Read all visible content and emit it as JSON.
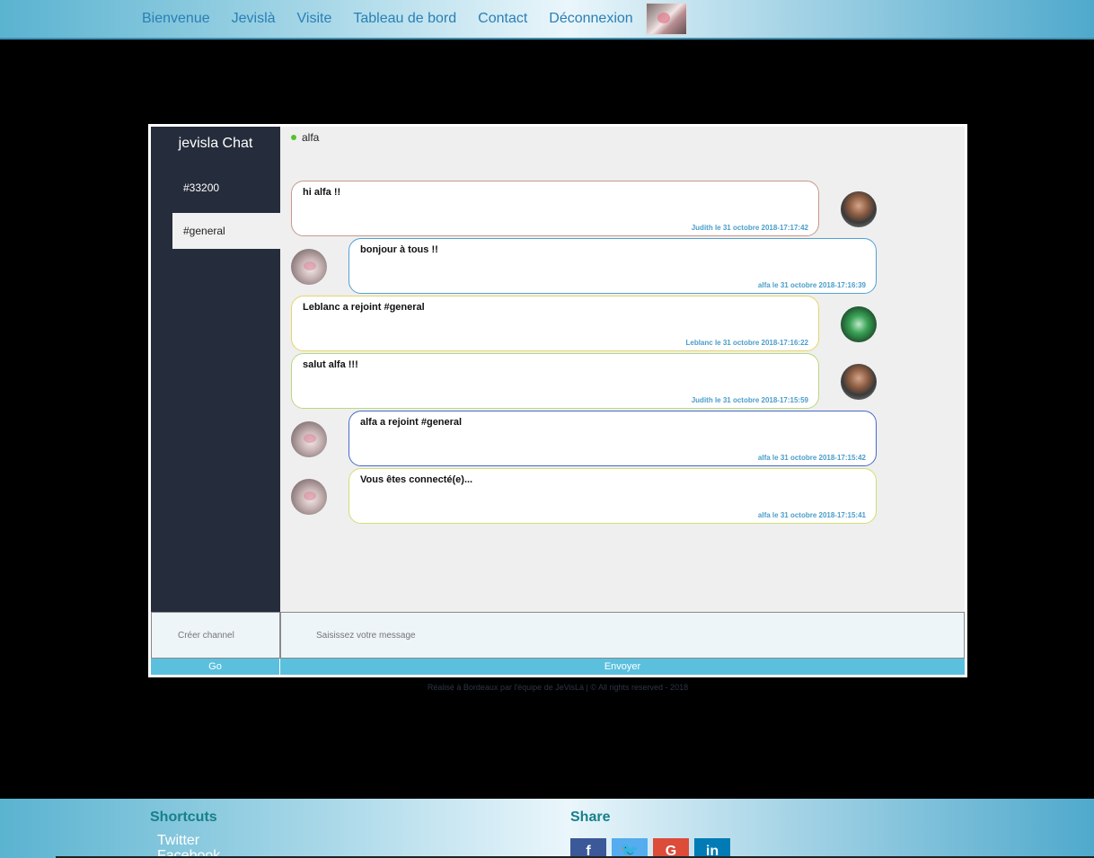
{
  "nav": {
    "items": [
      "Bienvenue",
      "Jevislà",
      "Visite",
      "Tableau de bord",
      "Contact",
      "Déconnexion"
    ],
    "avatar_icon": "user-photo"
  },
  "chat": {
    "title": "jevisla Chat",
    "channels": [
      "#33200",
      "#general"
    ],
    "active_channel": "#general",
    "online_user": "alfa",
    "messages": [
      {
        "text": "hi alfa !!",
        "meta": "Judith le 31 octobre 2018-17:17:42",
        "author": "Judith",
        "border": "#c9988c"
      },
      {
        "text": "bonjour à tous !!",
        "meta": "alfa le 31 octobre 2018-17:16:39",
        "author": "alfa",
        "border": "#4fa2d4"
      },
      {
        "text": "Leblanc a rejoint #general",
        "meta": "Leblanc le 31 octobre 2018-17:16:22",
        "author": "Leblanc",
        "border": "#e6d56a"
      },
      {
        "text": "salut alfa !!!",
        "meta": "Judith le 31 octobre 2018-17:15:59",
        "author": "Judith",
        "border": "#b7d97e"
      },
      {
        "text": "alfa a rejoint #general",
        "meta": "alfa le 31 octobre 2018-17:15:42",
        "author": "alfa",
        "border": "#4869c9"
      },
      {
        "text": "Vous êtes connecté(e)...",
        "meta": "alfa le 31 octobre 2018-17:15:41",
        "author": "alfa",
        "border": "#cfe070"
      }
    ],
    "create_channel_placeholder": "Créer channel",
    "message_placeholder": "Saisissez votre message",
    "go_label": "Go",
    "send_label": "Envoyer",
    "online_color": "#55c22a"
  },
  "credit": "Réalisé à Bordeaux par l'équipe de JeVisLà | © All rights reserved - 2018",
  "footer": {
    "shortcuts_title": "Shortcuts",
    "shortcuts": [
      "Twitter",
      "Facebook"
    ],
    "share_title": "Share",
    "share_buttons": [
      {
        "icon": "facebook-icon",
        "glyph": "f"
      },
      {
        "icon": "twitter-icon",
        "glyph": "🐦"
      },
      {
        "icon": "google-plus-icon",
        "glyph": "G"
      },
      {
        "icon": "linkedin-icon",
        "glyph": "in"
      }
    ]
  }
}
